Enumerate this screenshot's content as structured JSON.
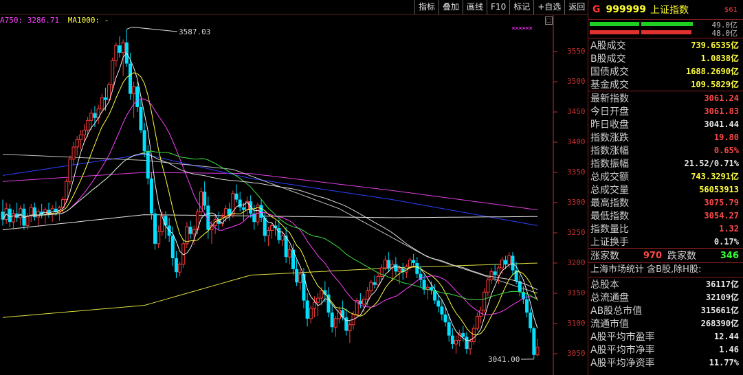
{
  "toolbar": {
    "items": [
      "指标",
      "叠加",
      "画线",
      "F10",
      "标记",
      "+自选",
      "返回"
    ]
  },
  "ma_legend": [
    {
      "text": "A750: 3286.71",
      "color": "#ff40ff"
    },
    {
      "text": "MA1000: -",
      "color": "#ffff40"
    }
  ],
  "annotations": {
    "high": "3587.03",
    "low": "3041.00",
    "marks": "××××××"
  },
  "colors": {
    "up": "#ff3c3c",
    "down": "#00e0ff",
    "axis": "#c83030"
  },
  "chart_data": {
    "type": "candlestick",
    "y_ticks": [
      3550,
      3500,
      3450,
      3400,
      3350,
      3300,
      3250,
      3200,
      3150,
      3100,
      3050
    ],
    "ohlc": [
      [
        3285,
        3305,
        3262,
        3272
      ],
      [
        3272,
        3300,
        3265,
        3290
      ],
      [
        3290,
        3298,
        3260,
        3268
      ],
      [
        3268,
        3288,
        3255,
        3282
      ],
      [
        3282,
        3300,
        3268,
        3275
      ],
      [
        3275,
        3295,
        3262,
        3290
      ],
      [
        3290,
        3298,
        3255,
        3262
      ],
      [
        3262,
        3282,
        3255,
        3278
      ],
      [
        3278,
        3298,
        3268,
        3292
      ],
      [
        3292,
        3300,
        3270,
        3276
      ],
      [
        3276,
        3290,
        3262,
        3285
      ],
      [
        3285,
        3298,
        3274,
        3280
      ],
      [
        3280,
        3292,
        3265,
        3288
      ],
      [
        3288,
        3300,
        3275,
        3282
      ],
      [
        3282,
        3296,
        3268,
        3290
      ],
      [
        3290,
        3302,
        3278,
        3284
      ],
      [
        3284,
        3295,
        3270,
        3292
      ],
      [
        3292,
        3310,
        3282,
        3305
      ],
      [
        3305,
        3340,
        3300,
        3335
      ],
      [
        3335,
        3378,
        3330,
        3372
      ],
      [
        3372,
        3400,
        3362,
        3392
      ],
      [
        3392,
        3410,
        3378,
        3404
      ],
      [
        3404,
        3420,
        3388,
        3412
      ],
      [
        3412,
        3430,
        3400,
        3420
      ],
      [
        3420,
        3442,
        3408,
        3436
      ],
      [
        3436,
        3455,
        3420,
        3448
      ],
      [
        3448,
        3460,
        3425,
        3440
      ],
      [
        3440,
        3462,
        3430,
        3455
      ],
      [
        3455,
        3480,
        3448,
        3474
      ],
      [
        3474,
        3490,
        3452,
        3470
      ],
      [
        3470,
        3500,
        3465,
        3495
      ],
      [
        3495,
        3540,
        3488,
        3535
      ],
      [
        3535,
        3565,
        3525,
        3560
      ],
      [
        3560,
        3575,
        3540,
        3548
      ],
      [
        3548,
        3570,
        3510,
        3565
      ],
      [
        3565,
        3587,
        3525,
        3530
      ],
      [
        3530,
        3548,
        3470,
        3480
      ],
      [
        3480,
        3500,
        3440,
        3492
      ],
      [
        3492,
        3500,
        3450,
        3458
      ],
      [
        3458,
        3470,
        3415,
        3420
      ],
      [
        3420,
        3432,
        3375,
        3385
      ],
      [
        3385,
        3395,
        3330,
        3340
      ],
      [
        3340,
        3350,
        3272,
        3282
      ],
      [
        3282,
        3290,
        3222,
        3232
      ],
      [
        3232,
        3262,
        3225,
        3252
      ],
      [
        3252,
        3285,
        3245,
        3278
      ],
      [
        3278,
        3286,
        3240,
        3262
      ],
      [
        3262,
        3275,
        3235,
        3245
      ],
      [
        3245,
        3260,
        3195,
        3208
      ],
      [
        3208,
        3220,
        3175,
        3185
      ],
      [
        3185,
        3202,
        3178,
        3198
      ],
      [
        3198,
        3240,
        3192,
        3232
      ],
      [
        3232,
        3268,
        3225,
        3260
      ],
      [
        3260,
        3270,
        3240,
        3248
      ],
      [
        3248,
        3262,
        3230,
        3255
      ],
      [
        3255,
        3290,
        3248,
        3285
      ],
      [
        3285,
        3325,
        3275,
        3318
      ],
      [
        3318,
        3335,
        3288,
        3295
      ],
      [
        3295,
        3310,
        3240,
        3255
      ],
      [
        3255,
        3270,
        3232,
        3262
      ],
      [
        3262,
        3278,
        3248,
        3272
      ],
      [
        3272,
        3285,
        3255,
        3265
      ],
      [
        3265,
        3282,
        3260,
        3276
      ],
      [
        3276,
        3296,
        3268,
        3290
      ],
      [
        3290,
        3300,
        3270,
        3280
      ],
      [
        3280,
        3320,
        3275,
        3315
      ],
      [
        3315,
        3330,
        3300,
        3305
      ],
      [
        3305,
        3318,
        3285,
        3292
      ],
      [
        3292,
        3300,
        3270,
        3288
      ],
      [
        3288,
        3310,
        3280,
        3302
      ],
      [
        3302,
        3312,
        3275,
        3282
      ],
      [
        3282,
        3296,
        3255,
        3268
      ],
      [
        3268,
        3300,
        3262,
        3296
      ],
      [
        3296,
        3305,
        3268,
        3275
      ],
      [
        3275,
        3285,
        3235,
        3245
      ],
      [
        3245,
        3260,
        3228,
        3254
      ],
      [
        3254,
        3268,
        3240,
        3262
      ],
      [
        3262,
        3270,
        3245,
        3258
      ],
      [
        3258,
        3272,
        3232,
        3238
      ],
      [
        3238,
        3252,
        3228,
        3245
      ],
      [
        3245,
        3260,
        3200,
        3210
      ],
      [
        3210,
        3230,
        3198,
        3222
      ],
      [
        3222,
        3232,
        3180,
        3190
      ],
      [
        3190,
        3205,
        3162,
        3168
      ],
      [
        3168,
        3190,
        3155,
        3182
      ],
      [
        3182,
        3192,
        3125,
        3138
      ],
      [
        3138,
        3150,
        3095,
        3108
      ],
      [
        3108,
        3130,
        3100,
        3125
      ],
      [
        3125,
        3145,
        3110,
        3135
      ],
      [
        3135,
        3150,
        3112,
        3142
      ],
      [
        3142,
        3160,
        3130,
        3155
      ],
      [
        3155,
        3170,
        3135,
        3148
      ],
      [
        3148,
        3160,
        3110,
        3118
      ],
      [
        3118,
        3130,
        3085,
        3094
      ],
      [
        3094,
        3112,
        3078,
        3108
      ],
      [
        3108,
        3128,
        3100,
        3122
      ],
      [
        3122,
        3138,
        3105,
        3110
      ],
      [
        3110,
        3125,
        3080,
        3088
      ],
      [
        3088,
        3105,
        3068,
        3098
      ],
      [
        3098,
        3120,
        3090,
        3115
      ],
      [
        3115,
        3142,
        3110,
        3138
      ],
      [
        3138,
        3150,
        3125,
        3132
      ],
      [
        3132,
        3145,
        3118,
        3140
      ],
      [
        3140,
        3160,
        3130,
        3154
      ],
      [
        3154,
        3172,
        3148,
        3168
      ],
      [
        3168,
        3180,
        3158,
        3164
      ],
      [
        3164,
        3185,
        3160,
        3178
      ],
      [
        3178,
        3198,
        3170,
        3192
      ],
      [
        3192,
        3212,
        3188,
        3205
      ],
      [
        3205,
        3218,
        3185,
        3192
      ],
      [
        3192,
        3205,
        3170,
        3198
      ],
      [
        3198,
        3210,
        3180,
        3186
      ],
      [
        3186,
        3196,
        3165,
        3190
      ],
      [
        3190,
        3200,
        3172,
        3185
      ],
      [
        3185,
        3198,
        3175,
        3194
      ],
      [
        3194,
        3210,
        3188,
        3205
      ],
      [
        3205,
        3215,
        3195,
        3200
      ],
      [
        3200,
        3210,
        3175,
        3182
      ],
      [
        3182,
        3195,
        3160,
        3172
      ],
      [
        3172,
        3180,
        3148,
        3156
      ],
      [
        3156,
        3165,
        3140,
        3160
      ],
      [
        3160,
        3170,
        3148,
        3155
      ],
      [
        3155,
        3165,
        3132,
        3138
      ],
      [
        3138,
        3148,
        3118,
        3128
      ],
      [
        3128,
        3140,
        3105,
        3115
      ],
      [
        3115,
        3128,
        3095,
        3102
      ],
      [
        3102,
        3115,
        3070,
        3080
      ],
      [
        3080,
        3092,
        3058,
        3066
      ],
      [
        3066,
        3080,
        3050,
        3072
      ],
      [
        3072,
        3090,
        3062,
        3084
      ],
      [
        3084,
        3096,
        3070,
        3078
      ],
      [
        3078,
        3086,
        3050,
        3058
      ],
      [
        3058,
        3075,
        3048,
        3070
      ],
      [
        3070,
        3098,
        3065,
        3092
      ],
      [
        3092,
        3118,
        3088,
        3112
      ],
      [
        3112,
        3128,
        3100,
        3122
      ],
      [
        3122,
        3158,
        3118,
        3152
      ],
      [
        3152,
        3178,
        3145,
        3172
      ],
      [
        3172,
        3192,
        3165,
        3186
      ],
      [
        3186,
        3198,
        3170,
        3180
      ],
      [
        3180,
        3196,
        3165,
        3192
      ],
      [
        3192,
        3210,
        3182,
        3205
      ],
      [
        3205,
        3212,
        3190,
        3198
      ],
      [
        3198,
        3218,
        3192,
        3212
      ],
      [
        3212,
        3218,
        3180,
        3188
      ],
      [
        3188,
        3202,
        3165,
        3170
      ],
      [
        3170,
        3180,
        3145,
        3152
      ],
      [
        3152,
        3162,
        3132,
        3140
      ],
      [
        3140,
        3148,
        3110,
        3118
      ],
      [
        3118,
        3125,
        3085,
        3092
      ],
      [
        3092,
        3095,
        3041,
        3048
      ],
      [
        3048,
        3075,
        3045,
        3061
      ]
    ]
  },
  "panel": {
    "title": {
      "g": "G",
      "code": "999999",
      "name": "上证指数",
      "sub": "$61"
    },
    "up_bar": "49.0亿",
    "down_bar": "48.0亿",
    "turnover": [
      {
        "k": "A股成交",
        "v": "739.6535亿"
      },
      {
        "k": "B股成交",
        "v": "1.0838亿"
      },
      {
        "k": "国债成交",
        "v": "1688.2690亿"
      },
      {
        "k": "基金成交",
        "v": "109.5829亿"
      }
    ],
    "stats": [
      {
        "k": "最新指数",
        "v": "3061.24",
        "c": "red"
      },
      {
        "k": "今日开盘",
        "v": "3061.83",
        "c": "red"
      },
      {
        "k": "昨日收盘",
        "v": "3041.44",
        "c": "white"
      },
      {
        "k": "指数涨跌",
        "v": "19.80",
        "c": "red"
      },
      {
        "k": "指数涨幅",
        "v": "0.65%",
        "c": "red"
      },
      {
        "k": "指数振幅",
        "v": "21.52/0.71%",
        "c": "white"
      },
      {
        "k": "总成交额",
        "v": "743.3291亿",
        "c": "yellow"
      },
      {
        "k": "总成交量",
        "v": "56053913",
        "c": "yellow"
      },
      {
        "k": "最高指数",
        "v": "3075.79",
        "c": "red"
      },
      {
        "k": "最低指数",
        "v": "3054.27",
        "c": "red"
      },
      {
        "k": "指数量比",
        "v": "1.32",
        "c": "red"
      },
      {
        "k": "上证换手",
        "v": "0.17%",
        "c": "white"
      }
    ],
    "breadth": {
      "up_label": "涨家数",
      "up": "970",
      "down_label": "跌家数",
      "down": "346"
    },
    "market_title": "上海市场统计 含B股,除H股:",
    "market": [
      {
        "k": "总股本",
        "v": "36117亿"
      },
      {
        "k": "总流通盘",
        "v": "32109亿"
      },
      {
        "k": "AB股总市值",
        "v": "315661亿"
      },
      {
        "k": "流通市值",
        "v": "268390亿"
      },
      {
        "k": "A股平均市盈率",
        "v": "12.44"
      },
      {
        "k": "A股平均市净率",
        "v": "1.46"
      },
      {
        "k": "A股平均净资率",
        "v": "11.77%"
      }
    ]
  }
}
